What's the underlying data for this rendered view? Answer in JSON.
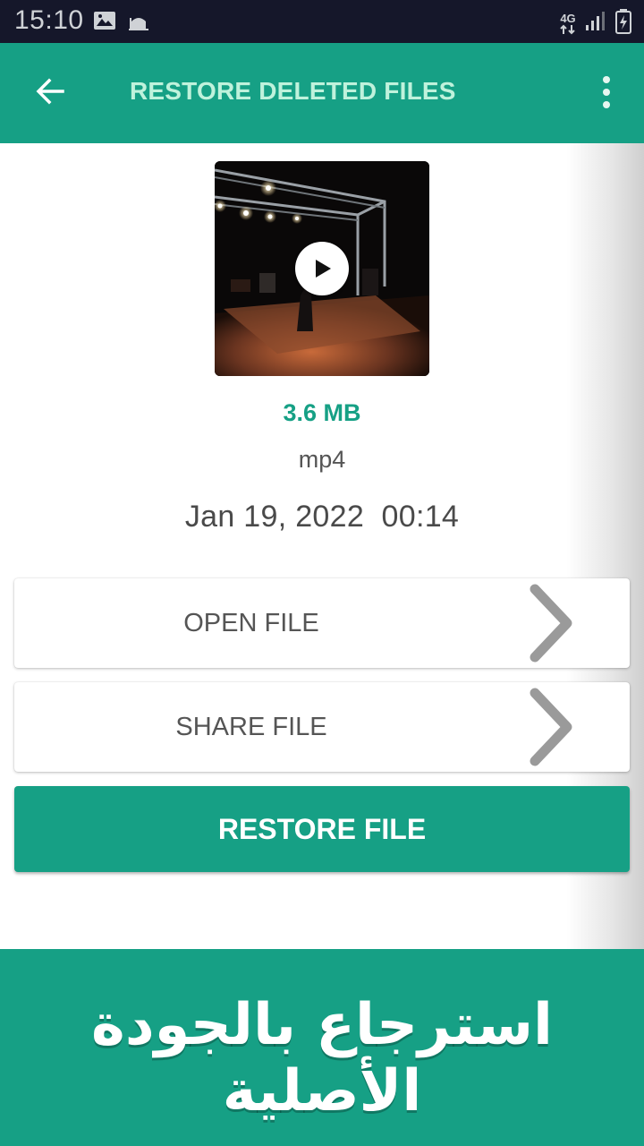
{
  "status_bar": {
    "time": "15:10",
    "network": "4G",
    "icons": [
      "image-icon",
      "mosque-icon",
      "network-4g-icon",
      "signal-icon",
      "battery-charging-icon"
    ]
  },
  "app_bar": {
    "title": "RESTORE DELETED FILES",
    "back_icon": "arrow-back-icon",
    "menu_icon": "more-vert-icon"
  },
  "file": {
    "size": "3.6 MB",
    "type": "mp4",
    "date": "Jan 19, 2022  00:14",
    "thumbnail": "video-thumbnail",
    "play_icon": "play-icon"
  },
  "actions": {
    "open_label": "OPEN FILE",
    "share_label": "SHARE FILE",
    "restore_label": "RESTORE FILE",
    "chevron_icon": "chevron-right-icon"
  },
  "promo": {
    "text": "استرجاع  بالجودة الأصلية"
  },
  "colors": {
    "primary": "#16a085",
    "status_bar": "#15172a",
    "title_text": "#bff2dc"
  }
}
